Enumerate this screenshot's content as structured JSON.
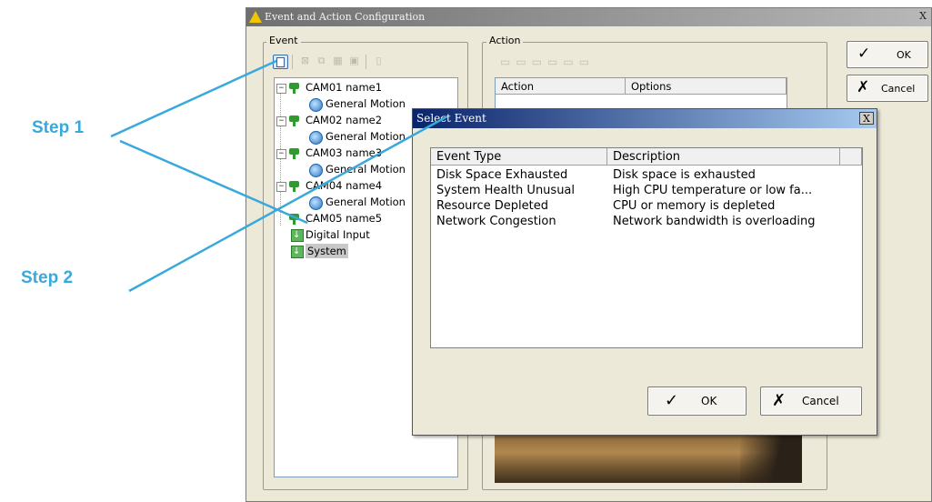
{
  "annotations": {
    "step1": "Step 1",
    "step2": "Step 2",
    "line_color": "#39a9dc"
  },
  "main_window": {
    "title": "Event and Action Configuration",
    "title_icon": "warning-icon",
    "close_glyph": "X",
    "event_group_label": "Event",
    "action_group_label": "Action",
    "action_columns": [
      "Action",
      "Options"
    ],
    "ok_label": "OK",
    "cancel_label": "Cancel",
    "event_tree": [
      {
        "label": "CAM01 name1",
        "type": "camera",
        "expanded": true
      },
      {
        "label": "General Motion",
        "type": "motion"
      },
      {
        "label": "CAM02 name2",
        "type": "camera",
        "expanded": true
      },
      {
        "label": "General Motion",
        "type": "motion"
      },
      {
        "label": "CAM03 name3",
        "type": "camera",
        "expanded": true
      },
      {
        "label": "General Motion",
        "type": "motion"
      },
      {
        "label": "CAM04 name4",
        "type": "camera",
        "expanded": true
      },
      {
        "label": "General Motion",
        "type": "motion"
      },
      {
        "label": "CAM05 name5",
        "type": "camera"
      },
      {
        "label": "Digital Input",
        "type": "io"
      },
      {
        "label": "System",
        "type": "io",
        "selected": true
      }
    ]
  },
  "dialog": {
    "title": "Select Event",
    "close_glyph": "X",
    "columns": [
      "Event Type",
      "Description"
    ],
    "rows": [
      [
        "Disk Space Exhausted",
        "Disk space is exhausted"
      ],
      [
        "System Health Unusual",
        "High CPU temperature or low fa..."
      ],
      [
        "Resource Depleted",
        "CPU or memory is depleted"
      ],
      [
        "Network Congestion",
        "Network bandwidth is overloading"
      ]
    ],
    "ok_label": "OK",
    "cancel_label": "Cancel"
  },
  "icons": {
    "ok": "✓",
    "cancel": "✗"
  }
}
